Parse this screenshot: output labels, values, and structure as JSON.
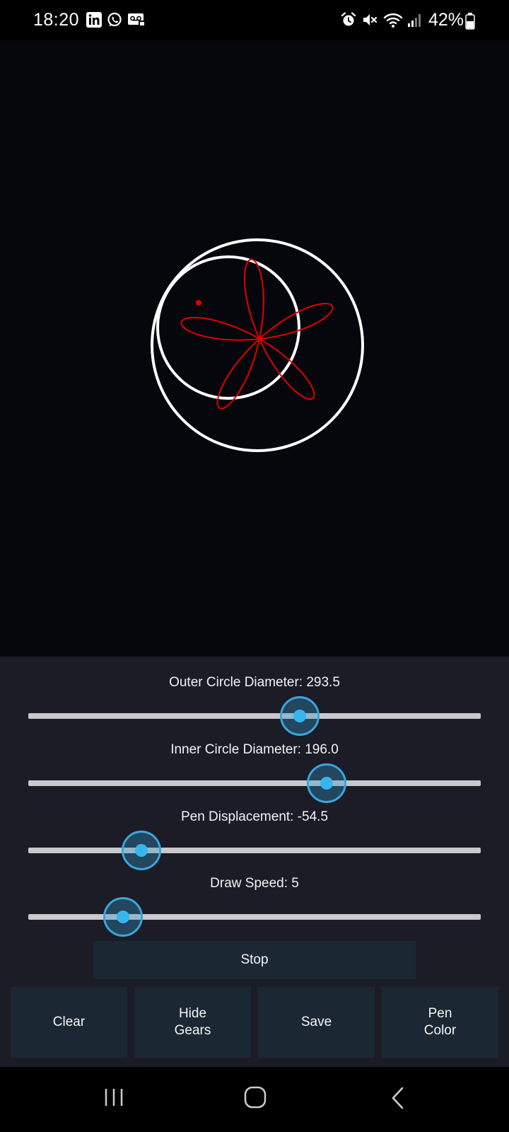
{
  "status_bar": {
    "time": "18:20",
    "battery_percent": "42%",
    "notification_icons": [
      "linkedin-icon",
      "whatsapp-icon",
      "voicemail-icon"
    ],
    "system_icons": [
      "alarm-icon",
      "mute-icon",
      "wifi-icon",
      "signal-icon",
      "battery-icon"
    ]
  },
  "canvas": {
    "background": "#06070d",
    "gear_color": "#ffffff",
    "pen_color": "#e00000"
  },
  "controls": {
    "outer": {
      "label": "Outer Circle Diameter: 293.5",
      "value_fraction": 0.6
    },
    "inner": {
      "label": "Inner Circle Diameter: 196.0",
      "value_fraction": 0.66
    },
    "pen": {
      "label": "Pen Displacement: -54.5",
      "value_fraction": 0.25
    },
    "speed": {
      "label": "Draw Speed: 5",
      "value_fraction": 0.21
    },
    "accent_color": "#38b6ec"
  },
  "buttons": {
    "stop": "Stop",
    "clear": "Clear",
    "hide_gears": "Hide\nGears",
    "save": "Save",
    "pen_color": "Pen\nColor"
  },
  "nav_bar": {
    "icons": [
      "recent-apps-icon",
      "home-icon",
      "back-icon"
    ]
  }
}
